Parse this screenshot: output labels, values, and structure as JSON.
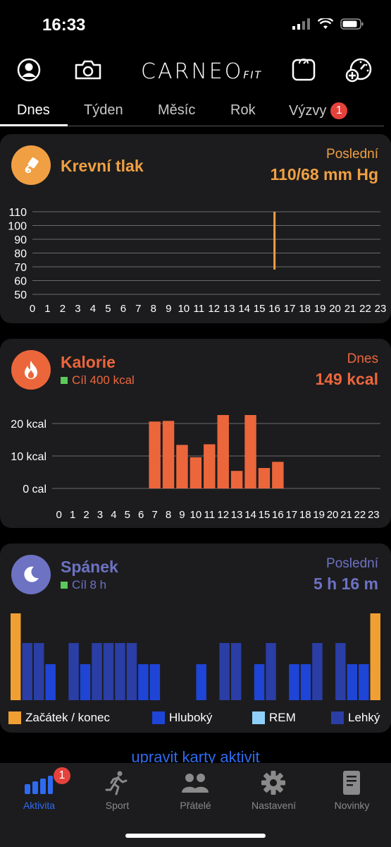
{
  "status": {
    "time": "16:33"
  },
  "header": {
    "logo_main": "CARNEO",
    "logo_sub": "FIT"
  },
  "tabs": [
    {
      "label": "Dnes",
      "active": true
    },
    {
      "label": "Týden"
    },
    {
      "label": "Měsíc"
    },
    {
      "label": "Rok"
    },
    {
      "label": "Výzvy",
      "badge": "1"
    }
  ],
  "cards": {
    "blood_pressure": {
      "title": "Krevní tlak",
      "right_label": "Poslední",
      "right_value": "110/68 mm Hg",
      "color": "#f0a043",
      "chart_data": {
        "type": "bar",
        "title": "",
        "y_ticks": [
          "110",
          "100",
          "90",
          "80",
          "70",
          "60",
          "50"
        ],
        "ylim": [
          50,
          110
        ],
        "x_ticks": [
          "0",
          "1",
          "2",
          "3",
          "4",
          "5",
          "6",
          "7",
          "8",
          "9",
          "10",
          "11",
          "12",
          "13",
          "14",
          "15",
          "16",
          "17",
          "18",
          "19",
          "20",
          "21",
          "22",
          "23"
        ],
        "series": [
          {
            "hour": 16,
            "systolic": 110,
            "diastolic": 68
          }
        ]
      }
    },
    "calories": {
      "title": "Kalorie",
      "subtitle": "Cíl 400 kcal",
      "right_label": "Dnes",
      "right_value": "149 kcal",
      "color": "#ec663c",
      "chart_data": {
        "type": "bar",
        "title": "",
        "y_ticks": [
          "20 kcal",
          "10 kcal",
          "0 cal"
        ],
        "ylim": [
          0,
          20
        ],
        "categories": [
          "0",
          "1",
          "2",
          "3",
          "4",
          "5",
          "6",
          "7",
          "8",
          "9",
          "10",
          "11",
          "12",
          "13",
          "14",
          "15",
          "16",
          "17",
          "18",
          "19",
          "20",
          "21",
          "22",
          "23"
        ],
        "values": [
          0,
          0,
          0,
          0,
          0,
          0,
          0,
          20.6,
          20.8,
          13.4,
          9.6,
          13.6,
          25.0,
          5.4,
          26.6,
          6.3,
          8.2,
          0,
          0,
          0,
          0,
          0,
          0,
          0
        ]
      }
    },
    "sleep": {
      "title": "Spánek",
      "subtitle": "Cíl 8 h",
      "right_label": "Poslední",
      "right_value": "5 h 16 m",
      "color": "#6d72c3",
      "chart_data": {
        "type": "bar",
        "title": "",
        "levels": {
          "start_end": 3,
          "light": 2,
          "deep": 1
        },
        "segments": [
          "start_end",
          "light",
          "light",
          "deep",
          "empty",
          "light",
          "deep",
          "light",
          "light",
          "light",
          "light",
          "deep",
          "deep",
          "empty",
          "empty",
          "empty",
          "deep",
          "empty",
          "light",
          "light",
          "empty",
          "deep",
          "light",
          "empty",
          "deep",
          "deep",
          "light",
          "empty",
          "light",
          "deep",
          "deep",
          "start_end"
        ]
      },
      "legend": [
        {
          "label": "Začátek / konec",
          "color": "#f0a033"
        },
        {
          "label": "Hluboký",
          "color": "#1e45d6"
        },
        {
          "label": "REM",
          "color": "#8fd0fa"
        },
        {
          "label": "Lehký",
          "color": "#2a3ea5"
        }
      ]
    }
  },
  "edit_link": "upravit karty aktivit",
  "bottom_nav": [
    {
      "label": "Aktivita",
      "active": true,
      "badge": "1",
      "icon": "activity-bars-icon"
    },
    {
      "label": "Sport",
      "icon": "runner-icon"
    },
    {
      "label": "Přátelé",
      "icon": "friends-icon"
    },
    {
      "label": "Nastavení",
      "icon": "gear-icon"
    },
    {
      "label": "Novinky",
      "icon": "news-icon"
    }
  ]
}
